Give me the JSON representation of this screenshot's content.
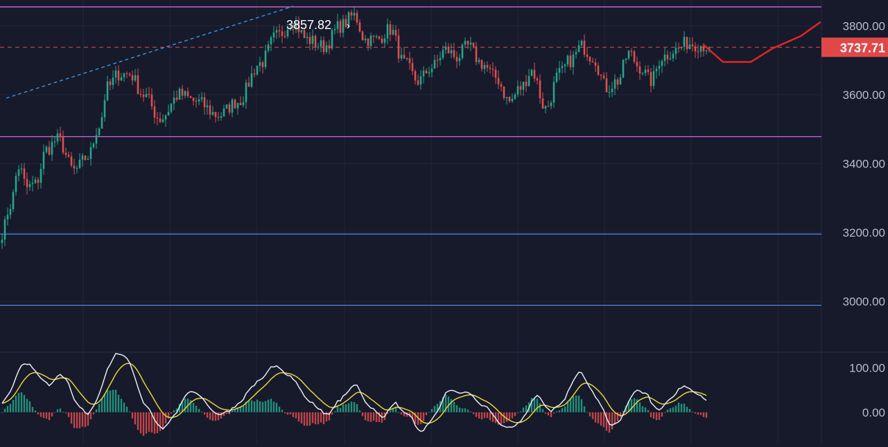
{
  "chart_data": [
    {
      "type": "candlestick",
      "panel": "price",
      "title": "",
      "xlabel": "",
      "ylabel": "",
      "ylim": [
        2860,
        3875
      ],
      "y_ticks": [
        "3800.00",
        "3600.00",
        "3400.00",
        "3200.00",
        "3000.00"
      ],
      "y_tick_values": [
        3800,
        3600,
        3400,
        3200,
        3000
      ],
      "grid": true,
      "last_price": 3737.71,
      "last_price_label": "3737.71",
      "peak_label": "3857.82",
      "peak_arrow": "›",
      "horizontal_levels": [
        {
          "value": 3855,
          "color": "#d36ad6"
        },
        {
          "value": 3478,
          "color": "#d36ad6"
        },
        {
          "value": 3195,
          "color": "#4f7fd6"
        },
        {
          "value": 2988,
          "color": "#4f7fd6"
        }
      ],
      "trend_line": {
        "from": [
          0,
          3590
        ],
        "to": [
          105,
          3857
        ],
        "color": "#3f8fe0"
      },
      "projection_path": [
        [
          253,
          3745
        ],
        [
          260,
          3695
        ],
        [
          270,
          3695
        ],
        [
          278,
          3735
        ],
        [
          288,
          3770
        ],
        [
          295,
          3810
        ]
      ],
      "candle_count": 256,
      "anchors": [
        [
          0,
          3200
        ],
        [
          3,
          3280
        ],
        [
          6,
          3390
        ],
        [
          9,
          3330
        ],
        [
          12,
          3340
        ],
        [
          16,
          3440
        ],
        [
          20,
          3470
        ],
        [
          26,
          3380
        ],
        [
          31,
          3420
        ],
        [
          35,
          3510
        ],
        [
          38,
          3620
        ],
        [
          42,
          3660
        ],
        [
          46,
          3660
        ],
        [
          51,
          3600
        ],
        [
          57,
          3530
        ],
        [
          64,
          3600
        ],
        [
          70,
          3580
        ],
        [
          78,
          3540
        ],
        [
          85,
          3580
        ],
        [
          93,
          3690
        ],
        [
          99,
          3770
        ],
        [
          105,
          3810
        ],
        [
          110,
          3760
        ],
        [
          116,
          3740
        ],
        [
          122,
          3800
        ],
        [
          127,
          3830
        ],
        [
          131,
          3760
        ],
        [
          135,
          3760
        ],
        [
          140,
          3790
        ],
        [
          145,
          3690
        ],
        [
          150,
          3640
        ],
        [
          155,
          3680
        ],
        [
          160,
          3730
        ],
        [
          164,
          3710
        ],
        [
          168,
          3740
        ],
        [
          173,
          3690
        ],
        [
          178,
          3650
        ],
        [
          183,
          3580
        ],
        [
          187,
          3620
        ],
        [
          191,
          3670
        ],
        [
          196,
          3560
        ],
        [
          201,
          3660
        ],
        [
          205,
          3700
        ],
        [
          209,
          3740
        ],
        [
          213,
          3710
        ],
        [
          218,
          3620
        ],
        [
          222,
          3640
        ],
        [
          226,
          3720
        ],
        [
          230,
          3680
        ],
        [
          234,
          3640
        ],
        [
          238,
          3710
        ],
        [
          243,
          3730
        ],
        [
          247,
          3750
        ],
        [
          252,
          3745
        ],
        [
          255,
          3738
        ]
      ]
    },
    {
      "type": "oscillator",
      "panel": "indicator",
      "ylim": [
        -70,
        130
      ],
      "y_ticks": [
        "100.00",
        "0.00"
      ],
      "y_tick_values": [
        100,
        0
      ],
      "series": [
        {
          "role": "fast",
          "color": "#e9e9ef"
        },
        {
          "role": "signal",
          "color": "#e6d33a"
        },
        {
          "role": "histogram",
          "up_color": "#26a68a",
          "down_color": "#e04e4e"
        }
      ]
    }
  ]
}
